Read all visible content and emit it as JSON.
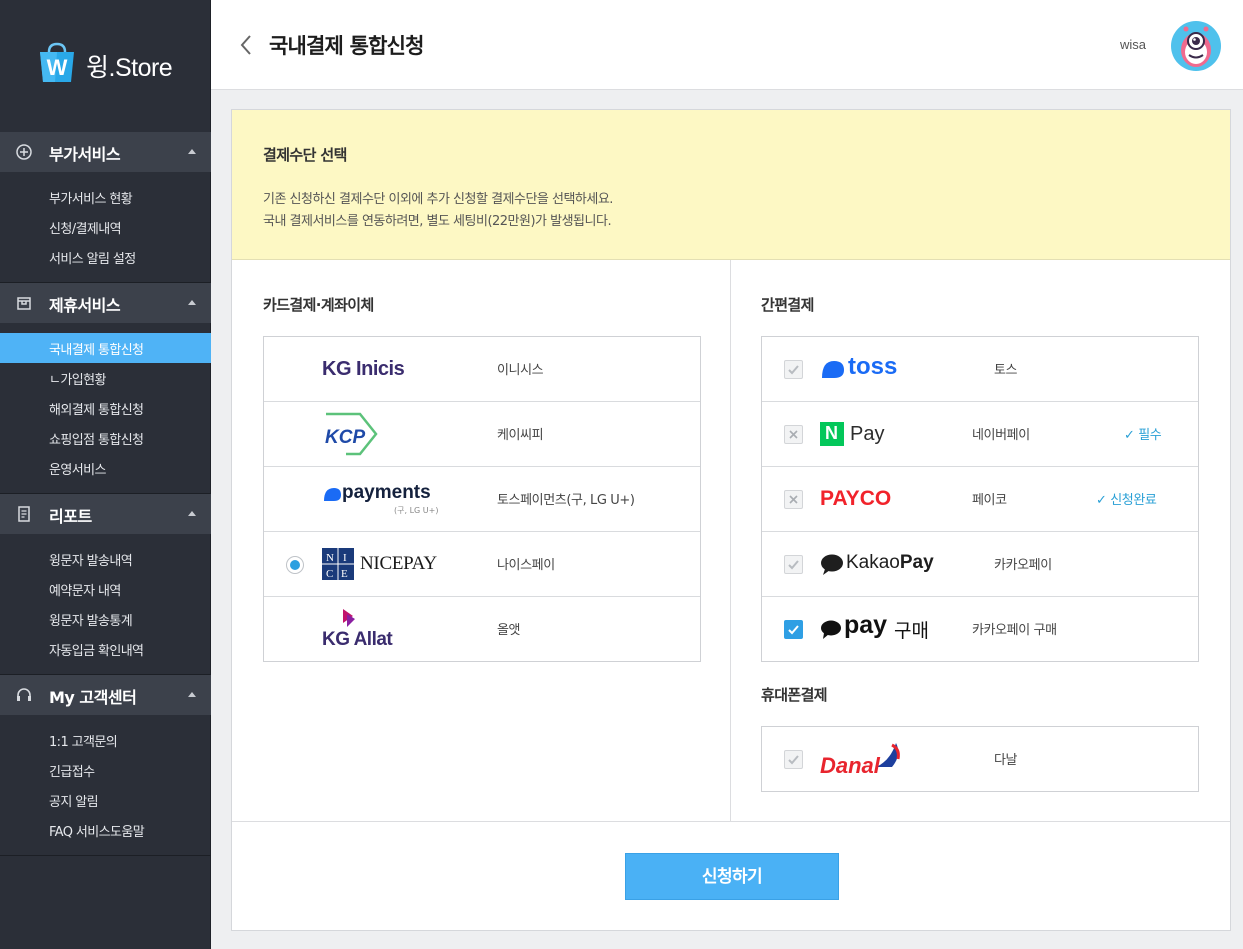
{
  "brand": {
    "name": "윙.Store",
    "bag_letter": "W"
  },
  "sidebar": {
    "sections": [
      {
        "label": "부가서비스",
        "icon": "plus-circle-icon",
        "items": [
          "부가서비스 현황",
          "신청/결제내역",
          "서비스 알림 설정"
        ]
      },
      {
        "label": "제휴서비스",
        "icon": "store-icon",
        "items": [
          "국내결제 통합신청",
          "ㄴ가입현황",
          "해외결제 통합신청",
          "쇼핑입점 통합신청",
          "운영서비스"
        ],
        "active_index": 0
      },
      {
        "label": "리포트",
        "icon": "report-icon",
        "items": [
          "윙문자 발송내역",
          "예약문자 내역",
          "윙문자 발송통계",
          "자동입금 확인내역"
        ]
      },
      {
        "label": "My 고객센터",
        "icon": "headset-icon",
        "items": [
          "1:1 고객문의",
          "긴급접수",
          "공지 알림",
          "FAQ 서비스도움말"
        ]
      }
    ]
  },
  "header": {
    "title": "국내결제 통합신청",
    "username": "wisa"
  },
  "notice": {
    "title": "결제수단 선택",
    "line1": "기존 신청하신 결제수단 이외에 추가 신청할 결제수단을 선택하세요.",
    "line2": "국내 결제서비스를 연동하려면, 별도 세팅비(22만원)가 발생됩니다."
  },
  "card_section": {
    "title": "카드결제·계좌이체",
    "providers": [
      {
        "name": "이니시스",
        "logo": "KG Inicis",
        "selected": false
      },
      {
        "name": "케이씨피",
        "logo": "KCP",
        "selected": false
      },
      {
        "name": "토스페이먼츠(구, LG U+)",
        "logo": "payments",
        "logo_sub": "(구, LG U+)",
        "selected": false
      },
      {
        "name": "나이스페이",
        "logo": "NICEPAY",
        "logo_mark": [
          "N",
          "I",
          "C",
          "E"
        ],
        "selected": true
      },
      {
        "name": "올앳",
        "logo": "KG Allat",
        "selected": false
      }
    ]
  },
  "easy_section": {
    "title": "간편결제",
    "providers": [
      {
        "name": "토스",
        "logo": "toss",
        "check": "disabled-checked",
        "status": ""
      },
      {
        "name": "네이버페이",
        "logo": "Pay",
        "logo_mark": "N",
        "check": "disabled-x",
        "status": "✓ 필수"
      },
      {
        "name": "페이코",
        "logo": "PAYCO",
        "check": "disabled-x",
        "status": "✓ 신청완료"
      },
      {
        "name": "카카오페이",
        "logo": "KakaoPay",
        "logo_parts": [
          "Kakao",
          "Pay"
        ],
        "check": "disabled-checked",
        "status": ""
      },
      {
        "name": "카카오페이 구매",
        "logo": "pay 구매",
        "logo_parts": [
          "pay",
          "구매"
        ],
        "check": "checked",
        "status": ""
      }
    ]
  },
  "mobile_section": {
    "title": "휴대폰결제",
    "providers": [
      {
        "name": "다날",
        "logo": "Danal",
        "check": "disabled-checked"
      }
    ]
  },
  "submit_label": "신청하기",
  "colors": {
    "accent": "#4ab1f5",
    "sidebar": "#2b2f38",
    "notice_bg": "#fdf8c4",
    "status": "#2aa0d6"
  }
}
